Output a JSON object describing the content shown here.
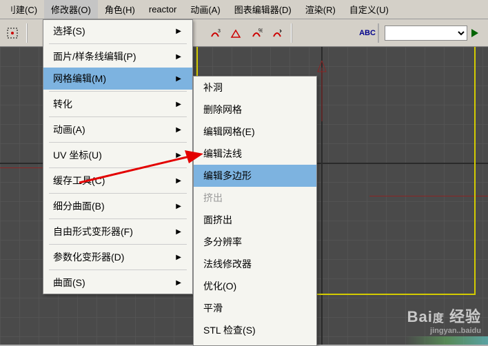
{
  "menubar": {
    "items": [
      {
        "label": "刂建(C)"
      },
      {
        "label": "修改器(O)",
        "active": true
      },
      {
        "label": "角色(H)"
      },
      {
        "label": "reactor"
      },
      {
        "label": "动画(A)"
      },
      {
        "label": "图表编辑器(D)"
      },
      {
        "label": "渲染(R)"
      },
      {
        "label": "自定义(U)"
      }
    ]
  },
  "toolbar": {
    "abc_label": "ABC"
  },
  "main_menu": {
    "items": [
      {
        "label": "选择(S)",
        "arrow": true
      },
      {
        "sep": true
      },
      {
        "label": "面片/样条线编辑(P)",
        "arrow": true
      },
      {
        "label": "网格编辑(M)",
        "arrow": true,
        "highlight": true
      },
      {
        "sep": true
      },
      {
        "label": "转化",
        "arrow": true
      },
      {
        "sep": true
      },
      {
        "label": "动画(A)",
        "arrow": true
      },
      {
        "sep": true
      },
      {
        "label": "UV 坐标(U)",
        "arrow": true
      },
      {
        "sep": true
      },
      {
        "label": "缓存工具(C)",
        "arrow": true
      },
      {
        "sep": true
      },
      {
        "label": "细分曲面(B)",
        "arrow": true
      },
      {
        "sep": true
      },
      {
        "label": "自由形式变形器(F)",
        "arrow": true
      },
      {
        "sep": true
      },
      {
        "label": "参数化变形器(D)",
        "arrow": true
      },
      {
        "sep": true
      },
      {
        "label": "曲面(S)",
        "arrow": true
      }
    ]
  },
  "sub_menu": {
    "items": [
      {
        "label": "补洞"
      },
      {
        "label": "删除网格"
      },
      {
        "label": "编辑网格(E)"
      },
      {
        "label": "编辑法线"
      },
      {
        "label": "编辑多边形",
        "highlight": true
      },
      {
        "label": "挤出",
        "disabled": true
      },
      {
        "label": "面挤出"
      },
      {
        "label": "多分辨率"
      },
      {
        "label": "法线修改器"
      },
      {
        "label": "优化(O)"
      },
      {
        "label": "平滑"
      },
      {
        "label": "STL 检查(S)"
      }
    ]
  },
  "watermark": {
    "brand": "Bai",
    "suffix": "经验",
    "line2": "jingyan..baidu"
  }
}
